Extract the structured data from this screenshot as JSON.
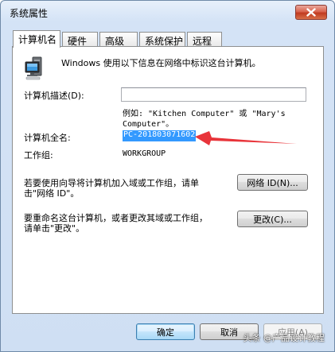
{
  "window": {
    "title": "系统属性"
  },
  "tabs": [
    {
      "label": "计算机名",
      "active": true
    },
    {
      "label": "硬件",
      "active": false
    },
    {
      "label": "高级",
      "active": false
    },
    {
      "label": "系统保护",
      "active": false
    },
    {
      "label": "远程",
      "active": false
    }
  ],
  "panel": {
    "intro_text": "Windows 使用以下信息在网络中标识这台计算机。",
    "description_label": "计算机描述(D):",
    "description_value": "",
    "example_line1": "例如: \"Kitchen Computer\" 或 \"Mary's",
    "example_line2": "Computer\"。",
    "fullname_label": "计算机全名:",
    "fullname_value": "PC-201803071602",
    "workgroup_label": "工作组:",
    "workgroup_value": "WORKGROUP",
    "network_text_line1": "若要使用向导将计算机加入域或工作组，请单",
    "network_text_line2": "击\"网络 ID\"。",
    "network_id_button": "网络 ID(N)...",
    "rename_text_line1": "要重命名这台计算机，或者更改其域或工作组，",
    "rename_text_line2": "请单击\"更改\"。",
    "change_button": "更改(C)..."
  },
  "footer": {
    "ok_button": "确定",
    "cancel_button": "取消",
    "apply_button": "应用(A)"
  },
  "watermark": "头条 @产品设计教程",
  "colors": {
    "selection": "#3399ff",
    "annotation_arrow": "#e8343a",
    "close_button": "#c94b33"
  }
}
